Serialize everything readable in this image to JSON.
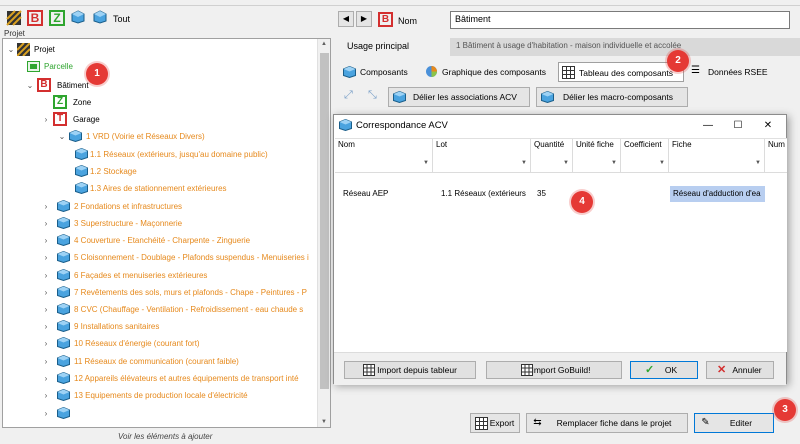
{
  "left_toolbar": {
    "tout_label": "Tout"
  },
  "tree": {
    "section_label": "Projet",
    "root": {
      "label": "Projet"
    },
    "parcelle": {
      "label": "Parcelle"
    },
    "batiment": {
      "label": "Bâtiment"
    },
    "zone": {
      "label": "Zone"
    },
    "garage": {
      "label": "Garage"
    },
    "lots": [
      {
        "label": "1 VRD (Voirie et Réseaux Divers)",
        "expanded": true,
        "children": [
          "1.1 Réseaux (extérieurs, jusqu'au domaine public)",
          "1.2 Stockage",
          "1.3 Aires de stationnement extérieures"
        ]
      },
      {
        "label": "2 Fondations et infrastructures"
      },
      {
        "label": "3 Superstructure - Maçonnerie"
      },
      {
        "label": "4 Couverture - Etanchéité - Charpente - Zinguerie"
      },
      {
        "label": "5 Cloisonnement - Doublage - Plafonds suspendus - Menuiseries i"
      },
      {
        "label": "6 Façades et menuiseries extérieures"
      },
      {
        "label": "7 Revêtements des sols, murs et plafonds - Chape - Peintures - P"
      },
      {
        "label": "8 CVC (Chauffage - Ventilation - Refroidissement - eau chaude s"
      },
      {
        "label": "9 Installations sanitaires"
      },
      {
        "label": "10 Réseaux d'énergie (courant fort)"
      },
      {
        "label": "11 Réseaux de communication (courant faible)"
      },
      {
        "label": "12 Appareils élévateurs et autres équipements de transport inté"
      },
      {
        "label": "13 Equipements de production locale d'électricité"
      }
    ],
    "bottom_hint": "Voir les éléments à ajouter"
  },
  "badges": [
    "1",
    "2",
    "3",
    "4"
  ],
  "right_panel": {
    "nom_label": "Nom",
    "nom_value": "Bâtiment",
    "usage_label": "Usage principal",
    "usage_value": "1 Bâtiment à usage d'habitation - maison individuelle et accolée",
    "tabs": [
      "Composants",
      "Graphique des composants",
      "Tableau des composants",
      "Données RSEE"
    ],
    "active_tab": "Tableau des composants",
    "delier_acv": "Délier les associations ACV",
    "delier_macro": "Délier les macro-composants",
    "export_label": "Export",
    "remplacer_label": "Remplacer fiche dans le projet",
    "editer_label": "Editer"
  },
  "dialog": {
    "title": "Correspondance ACV",
    "columns": [
      "Nom",
      "Lot",
      "Quantité",
      "Unité fiche",
      "Coefficient",
      "Fiche",
      "Num"
    ],
    "rows": [
      {
        "nom": "Réseau AEP",
        "lot": "1.1 Réseaux (extérieurs",
        "quantite": "35",
        "unite": "",
        "coefficient": "",
        "fiche": "Réseau d'adduction d'ea",
        "num": ""
      }
    ],
    "import_tableur": "Import depuis tableur",
    "import_gobuild": "Import GoBuild!",
    "ok_label": "OK",
    "annuler_label": "Annuler"
  },
  "colors": {
    "lot_text": "#e6891c",
    "badge": "#e53935",
    "selection": "#b8cef0",
    "parcelle_text": "#2fa52f"
  }
}
